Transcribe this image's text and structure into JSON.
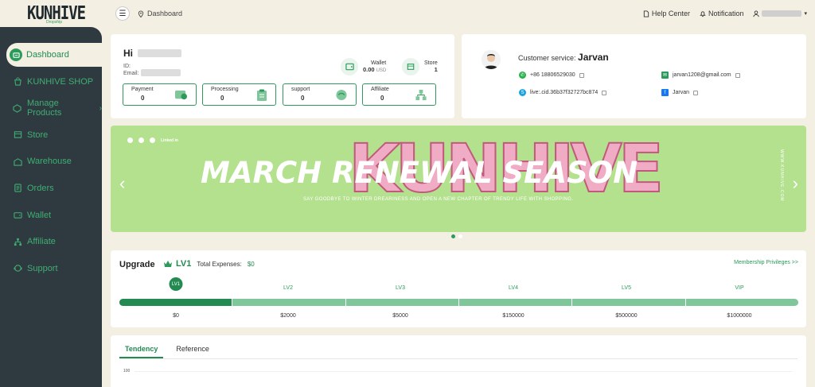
{
  "brand": {
    "logo_text": "KUNHIVE",
    "logo_sub": "Dropship"
  },
  "sidebar": {
    "items": [
      {
        "label": "Dashboard",
        "icon": "dashboard-icon"
      },
      {
        "label": "KUNHIVE SHOP",
        "icon": "shop-bag-icon"
      },
      {
        "label": "Manage Products",
        "icon": "products-icon"
      },
      {
        "label": "Store",
        "icon": "store-icon"
      },
      {
        "label": "Warehouse",
        "icon": "warehouse-icon"
      },
      {
        "label": "Orders",
        "icon": "orders-icon"
      },
      {
        "label": "Wallet",
        "icon": "wallet-icon"
      },
      {
        "label": "Affiliate",
        "icon": "affiliate-icon"
      },
      {
        "label": "Support",
        "icon": "support-icon"
      }
    ]
  },
  "header": {
    "breadcrumb": "Dashboard",
    "help": "Help Center",
    "notification": "Notification"
  },
  "profile": {
    "greeting": "Hi",
    "id_label": "ID:",
    "email_label": "Email:",
    "wallet_label": "Wallet",
    "wallet_value": "0.00",
    "wallet_unit": "USD",
    "store_label": "Store",
    "store_value": "1",
    "stats": [
      {
        "label": "Payment",
        "value": "0"
      },
      {
        "label": "Processing",
        "value": "0"
      },
      {
        "label": "support",
        "value": "0"
      },
      {
        "label": "Affiliate",
        "value": "0"
      }
    ]
  },
  "service": {
    "title": "Customer service:",
    "name": "Jarvan",
    "whatsapp": "+86 18806529030",
    "skype": "live:.cid.36b37f32727bc874",
    "email": "jarvan1208@gmail.com",
    "facebook": "Jarvan"
  },
  "banner": {
    "title": "MARCH RENEWAL SEASON",
    "subtitle": "SAY GOODBYE TO WINTER DREARINESS AND OPEN A NEW CHAPTER OF TRENDY LIFE WITH SHOPPING.",
    "logo": "KUNHIVE",
    "side_text": "WWW.KUNHIVE.COM",
    "social_text": "Linked in",
    "bg_color": "#b3e18d"
  },
  "upgrade": {
    "title": "Upgrade",
    "level": "LV1",
    "expenses_label": "Total Expenses:",
    "expenses_value": "$0",
    "link": "Membership Privileges >>",
    "levels": [
      "LV1",
      "LV2",
      "LV3",
      "LV4",
      "LV5",
      "VIP"
    ],
    "amounts": [
      "$0",
      "$2000",
      "$5000",
      "$150000",
      "$500000",
      "$1000000"
    ],
    "accent": "#238a52"
  },
  "tendency": {
    "tabs": [
      "Tendency",
      "Reference"
    ],
    "y_tick": "100"
  }
}
